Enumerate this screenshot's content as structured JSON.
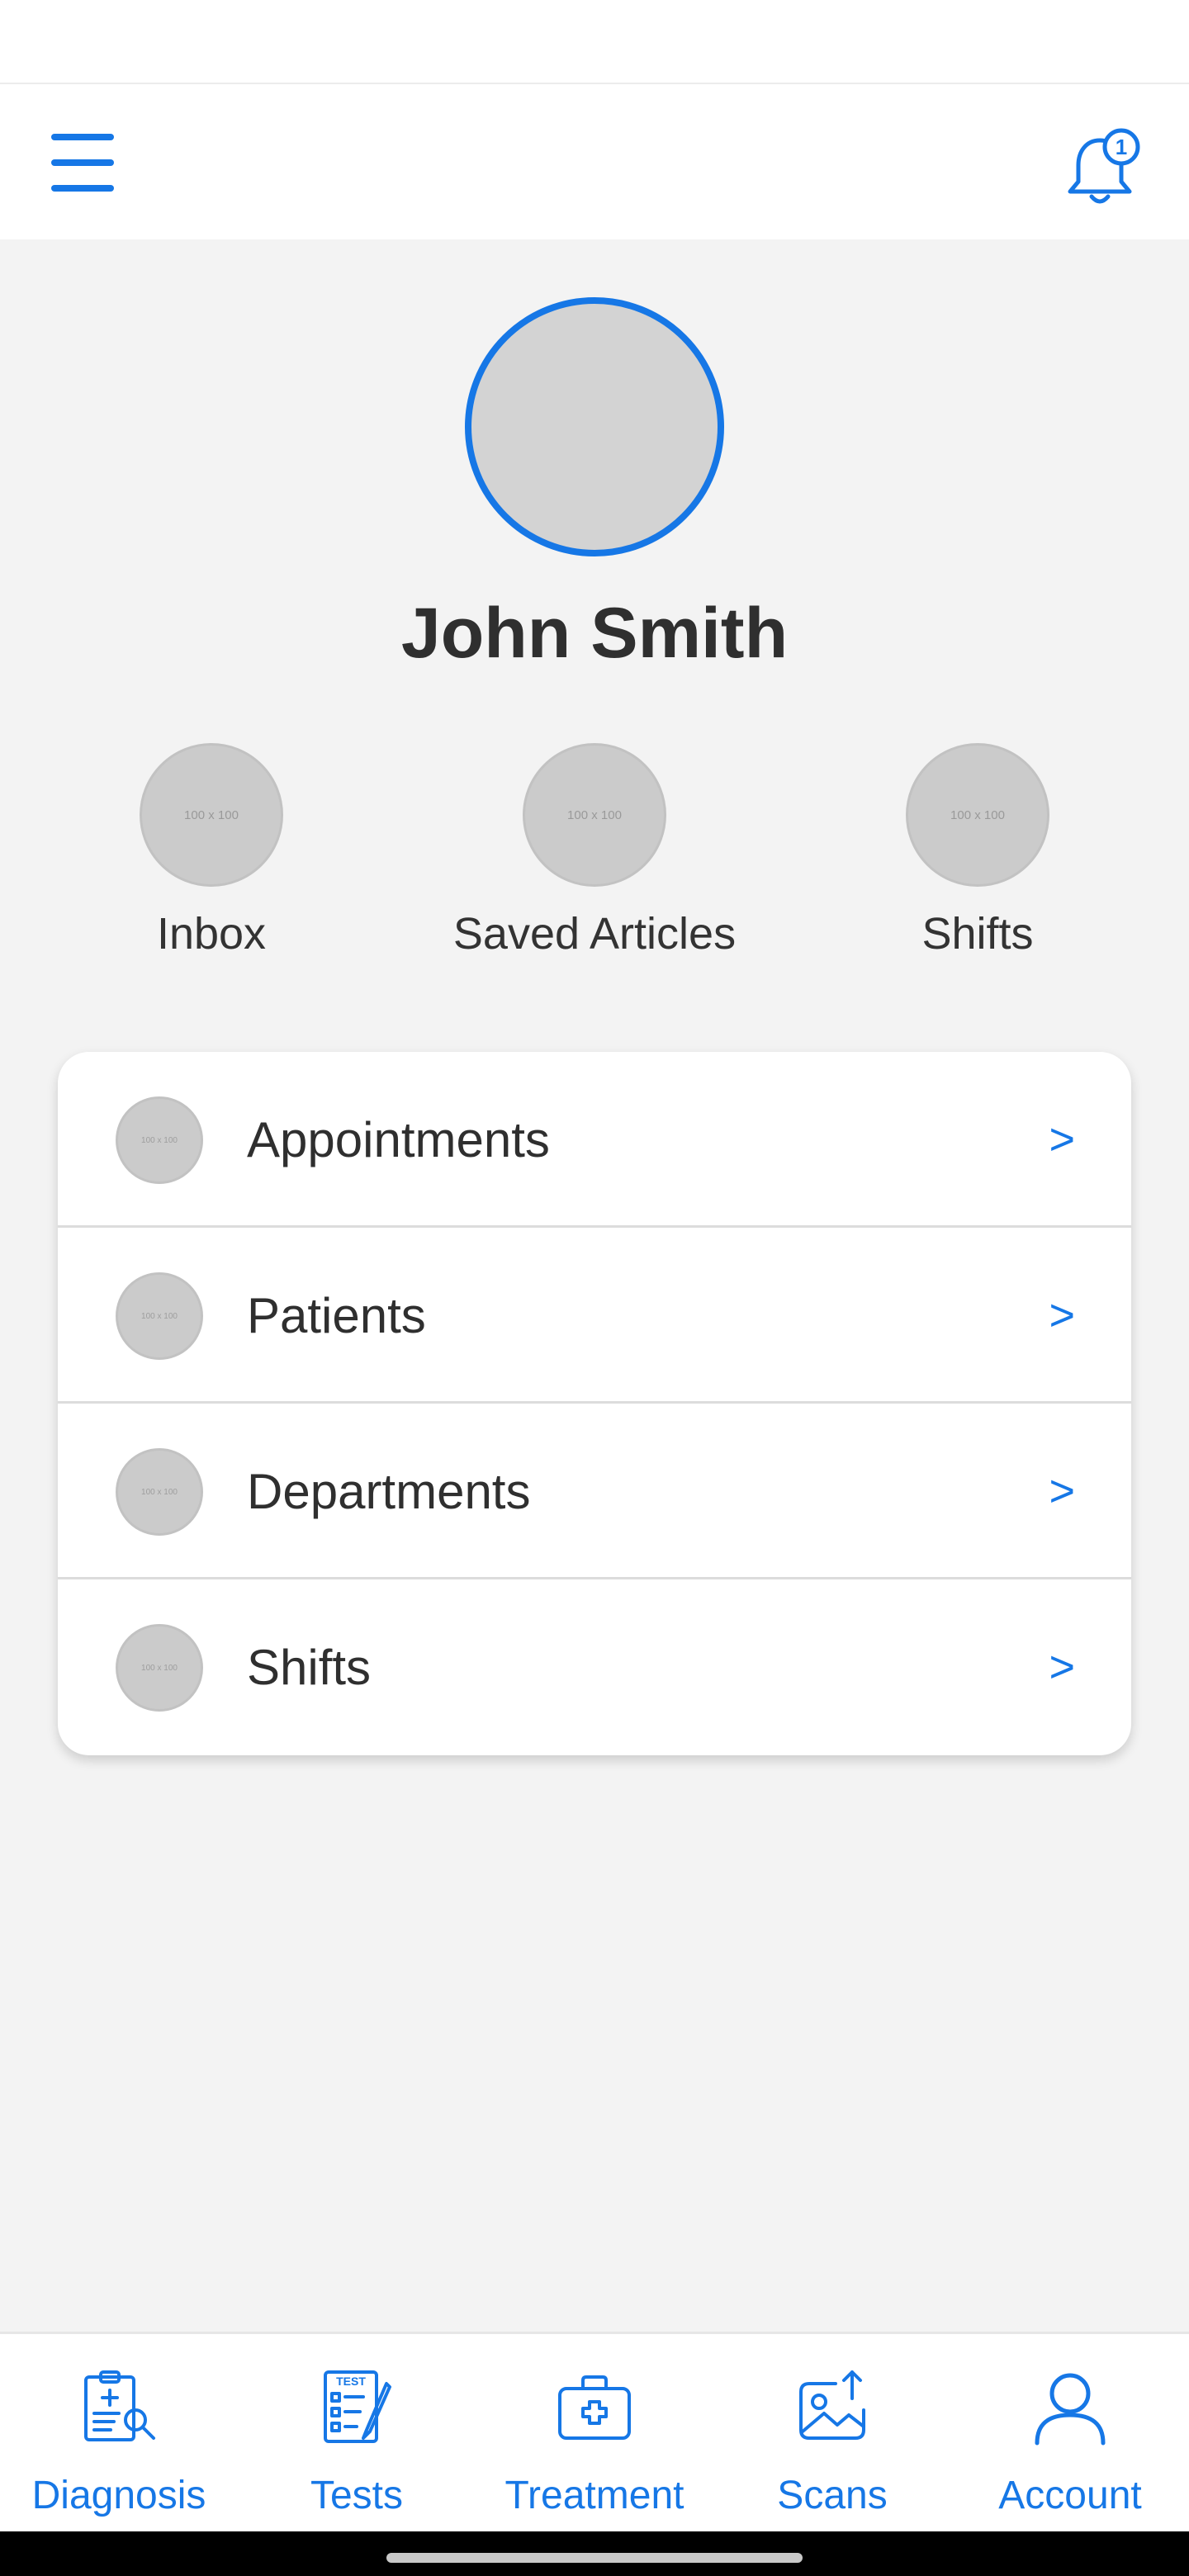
{
  "header": {
    "menu_icon": "hamburger-menu-icon",
    "notification_icon": "bell-icon",
    "notification_count": "1",
    "accent_color": "#1677e6"
  },
  "profile": {
    "name": "John Smith"
  },
  "quick_links": [
    {
      "label": "Inbox",
      "placeholder": "100 x 100"
    },
    {
      "label": "Saved Articles",
      "placeholder": "100 x 100"
    },
    {
      "label": "Shifts",
      "placeholder": "100 x 100"
    }
  ],
  "menu": [
    {
      "label": "Appointments",
      "placeholder": "100 x 100",
      "chevron": ">"
    },
    {
      "label": "Patients",
      "placeholder": "100 x 100",
      "chevron": ">"
    },
    {
      "label": "Departments",
      "placeholder": "100 x 100",
      "chevron": ">"
    },
    {
      "label": "Shifts",
      "placeholder": "100 x 100",
      "chevron": ">"
    }
  ],
  "bottom_nav": [
    {
      "label": "Diagnosis",
      "icon": "diagnosis-clipboard-icon"
    },
    {
      "label": "Tests",
      "icon": "test-checklist-icon",
      "icon_text": "TEST"
    },
    {
      "label": "Treatment",
      "icon": "medical-kit-icon"
    },
    {
      "label": "Scans",
      "icon": "scan-upload-icon"
    },
    {
      "label": "Account",
      "icon": "user-icon"
    }
  ]
}
